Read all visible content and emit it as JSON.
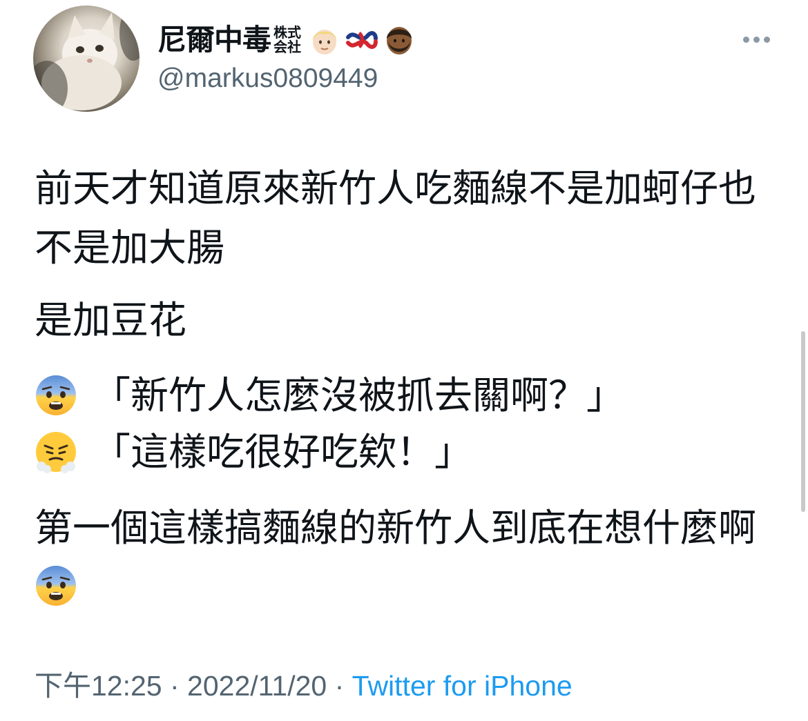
{
  "author": {
    "display_name": "尼爾中毒",
    "name_suffix_top": "株式",
    "name_suffix_bottom": "会社",
    "name_emojis": [
      "person-blond-light-skin-icon",
      "knot-icon",
      "man-beard-medium-dark-skin-icon"
    ],
    "handle": "@markus0809449",
    "avatar": "white-cat-avatar"
  },
  "tweet": {
    "paragraph_1": "前天才知道原來新竹人吃麵線不是加蚵仔也不是加大腸",
    "paragraph_2": "是加豆花",
    "quote_1": "「新竹人怎麼沒被抓去關啊？」",
    "quote_1_emoji": "fearful-face-icon",
    "quote_2": "「這樣吃很好吃欸！」",
    "quote_2_emoji": "face-with-steam-icon",
    "paragraph_last": "第一個這樣搞麵線的新竹人到底在想什麼啊",
    "paragraph_last_emoji": "fearful-face-icon"
  },
  "meta": {
    "time": "下午12:25",
    "separator": " · ",
    "date": "2022/11/20",
    "source": "Twitter for iPhone"
  },
  "colors": {
    "text": "#0f1419",
    "secondary": "#536471",
    "link": "#1d9bf0"
  }
}
